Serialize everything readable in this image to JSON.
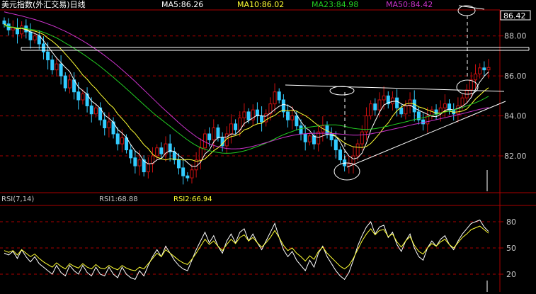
{
  "header": {
    "title": "美元指数(外汇交易)日线",
    "ma5_label": "MA5:86.26",
    "ma10_label": "MA10:86.02",
    "ma23_label": "MA23:84.98",
    "ma50_label": "MA50:84.42"
  },
  "price_box_label": "86.42",
  "rsi_header": {
    "title": "RSI(7,14)",
    "rsi1_label": "RSI1:68.88",
    "rsi2_label": "RSI2:66.94"
  },
  "colors": {
    "background": "#000000",
    "up_candle": "#cc1010",
    "down_candle": "#33ccff",
    "ma5": "#ffffff",
    "ma10": "#ffff33",
    "ma23": "#22cc22",
    "ma50": "#cc33cc",
    "grid": "#aa0000",
    "axis_text": "#c8c8c8",
    "title": "#ffffff",
    "trendline": "#ffffff"
  },
  "chart_data": {
    "type": "line",
    "price_axis": {
      "ticks": [
        "88.00",
        "86.00",
        "84.00",
        "82.00"
      ],
      "ylim": [
        80.3,
        89.3
      ]
    },
    "rsi_axis": {
      "ticks": [
        "80",
        "50",
        "20"
      ],
      "ylim": [
        3,
        97
      ]
    },
    "close": [
      88.6,
      88.3,
      88.4,
      88.1,
      88.5,
      88.2,
      87.8,
      88.0,
      87.6,
      87.2,
      86.8,
      86.3,
      86.6,
      86.0,
      85.4,
      85.8,
      85.2,
      84.8,
      85.1,
      84.5,
      84.1,
      84.4,
      83.8,
      83.4,
      83.7,
      83.1,
      82.6,
      82.9,
      82.3,
      81.9,
      81.5,
      81.8,
      81.2,
      81.6,
      82.0,
      82.4,
      82.1,
      82.6,
      82.2,
      81.8,
      81.4,
      81.0,
      80.9,
      81.3,
      81.8,
      82.4,
      83.1,
      82.8,
      83.4,
      82.9,
      82.5,
      83.1,
      83.6,
      83.3,
      83.9,
      84.2,
      83.8,
      84.3,
      84.0,
      83.7,
      84.1,
      84.6,
      85.2,
      84.8,
      84.2,
      83.8,
      84.0,
      83.5,
      83.1,
      82.7,
      83.0,
      82.6,
      83.2,
      83.5,
      83.1,
      82.8,
      82.3,
      81.8,
      81.5,
      81.6,
      82.0,
      82.6,
      83.2,
      84.0,
      84.6,
      84.3,
      84.8,
      85.0,
      84.6,
      84.9,
      84.4,
      84.1,
      84.5,
      84.8,
      84.2,
      83.8,
      83.6,
      84.0,
      84.3,
      84.1,
      84.4,
      84.6,
      84.3,
      84.1,
      84.5,
      84.9,
      85.3,
      85.8,
      86.1,
      86.4,
      86.3,
      86.42
    ],
    "series": [
      {
        "name": "MA5",
        "values": [
          88.6,
          88.45,
          88.43,
          88.35,
          88.38,
          88.3,
          88.2,
          88.12,
          88.02,
          87.76,
          87.48,
          87.18,
          86.9,
          86.66,
          86.42,
          86.22,
          85.8,
          85.44,
          85.26,
          85.08,
          84.74,
          84.58,
          84.38,
          84.04,
          83.88,
          83.68,
          83.32,
          83.14,
          82.92,
          82.56,
          82.24,
          82.08,
          81.74,
          81.6,
          81.62,
          81.8,
          81.86,
          82.14,
          82.26,
          82.22,
          82.02,
          81.86,
          81.66,
          81.48,
          81.48,
          81.68,
          82.1,
          82.28,
          82.7,
          82.92,
          82.94,
          82.94,
          83.1,
          83.08,
          83.28,
          83.62,
          83.76,
          83.9,
          84.04,
          84.0,
          83.98,
          84.14,
          84.32,
          84.48,
          84.58,
          84.52,
          84.4,
          84.06,
          83.72,
          83.42,
          83.26,
          82.98,
          82.92,
          83.0,
          83.08,
          83.04,
          82.98,
          82.7,
          82.3,
          82.0,
          81.84,
          81.9,
          82.14,
          82.64,
          83.28,
          83.74,
          84.18,
          84.54,
          84.66,
          84.72,
          84.74,
          84.6,
          84.5,
          84.54,
          84.4,
          84.28,
          84.18,
          84.08,
          83.98,
          83.96,
          84.08,
          84.28,
          84.34,
          84.3,
          84.38,
          84.48,
          84.64,
          84.92,
          85.32,
          85.7,
          85.98,
          86.2
        ]
      },
      {
        "name": "MA10",
        "values": [
          88.6,
          88.45,
          88.43,
          88.35,
          88.38,
          88.33,
          88.27,
          88.24,
          88.17,
          88.07,
          87.89,
          87.74,
          87.56,
          87.34,
          87.1,
          86.86,
          86.6,
          86.33,
          86.04,
          85.83,
          85.57,
          85.36,
          85.09,
          84.86,
          84.6,
          84.41,
          84.1,
          83.86,
          83.62,
          83.33,
          83.12,
          82.84,
          82.56,
          82.36,
          82.08,
          81.93,
          81.86,
          81.79,
          81.86,
          81.83,
          81.82,
          81.79,
          81.82,
          81.8,
          81.73,
          81.76,
          81.85,
          82.05,
          82.26,
          82.4,
          82.6,
          82.86,
          82.96,
          83.01,
          83.1,
          83.3,
          83.37,
          83.51,
          83.6,
          83.63,
          83.8,
          83.93,
          84.02,
          84.2,
          84.29,
          84.25,
          84.28,
          84.24,
          84.12,
          84.01,
          83.86,
          83.68,
          83.51,
          83.36,
          83.25,
          83.15,
          82.98,
          82.81,
          82.65,
          82.54,
          82.45,
          82.43,
          82.42,
          82.47,
          82.62,
          82.86,
          83.11,
          83.41,
          83.65,
          83.98,
          84.26,
          84.44,
          84.59,
          84.63,
          84.59,
          84.45,
          84.39,
          84.3,
          84.22,
          84.14,
          84.14,
          84.23,
          84.24,
          84.18,
          84.2,
          84.24,
          84.34,
          84.58,
          84.84,
          85.04,
          85.24,
          85.41
        ]
      },
      {
        "name": "MA23",
        "values": [
          88.5,
          88.47,
          88.44,
          88.4,
          88.4,
          88.37,
          88.33,
          88.3,
          88.25,
          88.18,
          88.1,
          88.0,
          87.9,
          87.78,
          87.64,
          87.52,
          87.38,
          87.24,
          87.1,
          86.95,
          86.79,
          86.64,
          86.47,
          86.29,
          86.11,
          85.93,
          85.74,
          85.55,
          85.36,
          85.16,
          84.96,
          84.76,
          84.56,
          84.36,
          84.17,
          83.99,
          83.82,
          83.65,
          83.48,
          83.3,
          83.13,
          82.96,
          82.8,
          82.65,
          82.52,
          82.41,
          82.33,
          82.26,
          82.21,
          82.17,
          82.14,
          82.13,
          82.14,
          82.16,
          82.2,
          82.25,
          82.31,
          82.39,
          82.47,
          82.55,
          82.64,
          82.74,
          82.85,
          82.96,
          83.06,
          83.14,
          83.22,
          83.3,
          83.36,
          83.4,
          83.44,
          83.47,
          83.5,
          83.53,
          83.55,
          83.55,
          83.55,
          83.52,
          83.48,
          83.43,
          83.38,
          83.35,
          83.33,
          83.32,
          83.34,
          83.36,
          83.4,
          83.45,
          83.49,
          83.55,
          83.6,
          83.65,
          83.7,
          83.76,
          83.82,
          83.86,
          83.91,
          83.96,
          84.02,
          84.07,
          84.13,
          84.19,
          84.24,
          84.3,
          84.35,
          84.42,
          84.5,
          84.58,
          84.66,
          84.75,
          84.86,
          84.98
        ]
      },
      {
        "name": "MA50",
        "values": [
          89.2,
          89.15,
          89.1,
          89.05,
          89.0,
          88.94,
          88.88,
          88.82,
          88.75,
          88.68,
          88.6,
          88.52,
          88.43,
          88.33,
          88.23,
          88.12,
          88.0,
          87.88,
          87.75,
          87.62,
          87.48,
          87.33,
          87.18,
          87.02,
          86.85,
          86.68,
          86.5,
          86.31,
          86.12,
          85.92,
          85.72,
          85.51,
          85.3,
          85.09,
          84.88,
          84.67,
          84.46,
          84.26,
          84.06,
          83.86,
          83.66,
          83.47,
          83.29,
          83.12,
          82.96,
          82.82,
          82.7,
          82.6,
          82.52,
          82.46,
          82.41,
          82.37,
          82.35,
          82.35,
          82.36,
          82.39,
          82.43,
          82.48,
          82.54,
          82.6,
          82.66,
          82.72,
          82.79,
          82.86,
          82.92,
          82.97,
          83.02,
          83.06,
          83.09,
          83.11,
          83.12,
          83.13,
          83.13,
          83.13,
          83.13,
          83.12,
          83.11,
          83.09,
          83.07,
          83.05,
          83.04,
          83.04,
          83.05,
          83.07,
          83.1,
          83.14,
          83.18,
          83.23,
          83.28,
          83.33,
          83.38,
          83.43,
          83.48,
          83.53,
          83.58,
          83.62,
          83.67,
          83.71,
          83.76,
          83.81,
          83.86,
          83.91,
          83.96,
          84.01,
          84.06,
          84.11,
          84.17,
          84.22,
          84.28,
          84.33,
          84.38,
          84.42
        ]
      }
    ],
    "rsi_series": [
      {
        "name": "RSI1",
        "values": [
          44,
          42,
          46,
          38,
          48,
          40,
          34,
          40,
          32,
          28,
          24,
          20,
          30,
          22,
          18,
          30,
          24,
          20,
          30,
          22,
          18,
          28,
          20,
          18,
          28,
          20,
          16,
          28,
          20,
          16,
          14,
          24,
          18,
          30,
          40,
          48,
          40,
          52,
          44,
          36,
          30,
          26,
          24,
          36,
          48,
          58,
          68,
          56,
          64,
          52,
          44,
          58,
          66,
          56,
          68,
          72,
          58,
          66,
          56,
          48,
          58,
          68,
          78,
          62,
          48,
          40,
          46,
          36,
          30,
          24,
          36,
          28,
          44,
          52,
          40,
          32,
          24,
          18,
          14,
          22,
          36,
          52,
          64,
          74,
          80,
          66,
          74,
          76,
          62,
          68,
          54,
          46,
          58,
          66,
          50,
          40,
          36,
          50,
          58,
          52,
          60,
          64,
          54,
          48,
          58,
          66,
          72,
          78,
          80,
          82,
          74,
          68.88
        ]
      },
      {
        "name": "RSI2",
        "values": [
          47,
          45,
          47,
          42,
          48,
          44,
          40,
          43,
          38,
          34,
          31,
          28,
          33,
          29,
          26,
          32,
          29,
          27,
          32,
          28,
          26,
          31,
          27,
          26,
          30,
          27,
          25,
          30,
          27,
          25,
          24,
          28,
          26,
          32,
          38,
          44,
          40,
          48,
          44,
          40,
          36,
          33,
          31,
          37,
          44,
          52,
          60,
          54,
          58,
          52,
          47,
          54,
          60,
          55,
          62,
          65,
          58,
          62,
          56,
          51,
          56,
          62,
          70,
          62,
          53,
          47,
          50,
          44,
          40,
          35,
          41,
          37,
          46,
          51,
          44,
          39,
          34,
          29,
          26,
          30,
          38,
          48,
          58,
          66,
          72,
          65,
          70,
          71,
          63,
          66,
          57,
          51,
          58,
          63,
          53,
          46,
          43,
          50,
          55,
          52,
          57,
          60,
          54,
          50,
          56,
          62,
          66,
          71,
          73,
          75,
          71,
          66.94
        ]
      }
    ]
  }
}
